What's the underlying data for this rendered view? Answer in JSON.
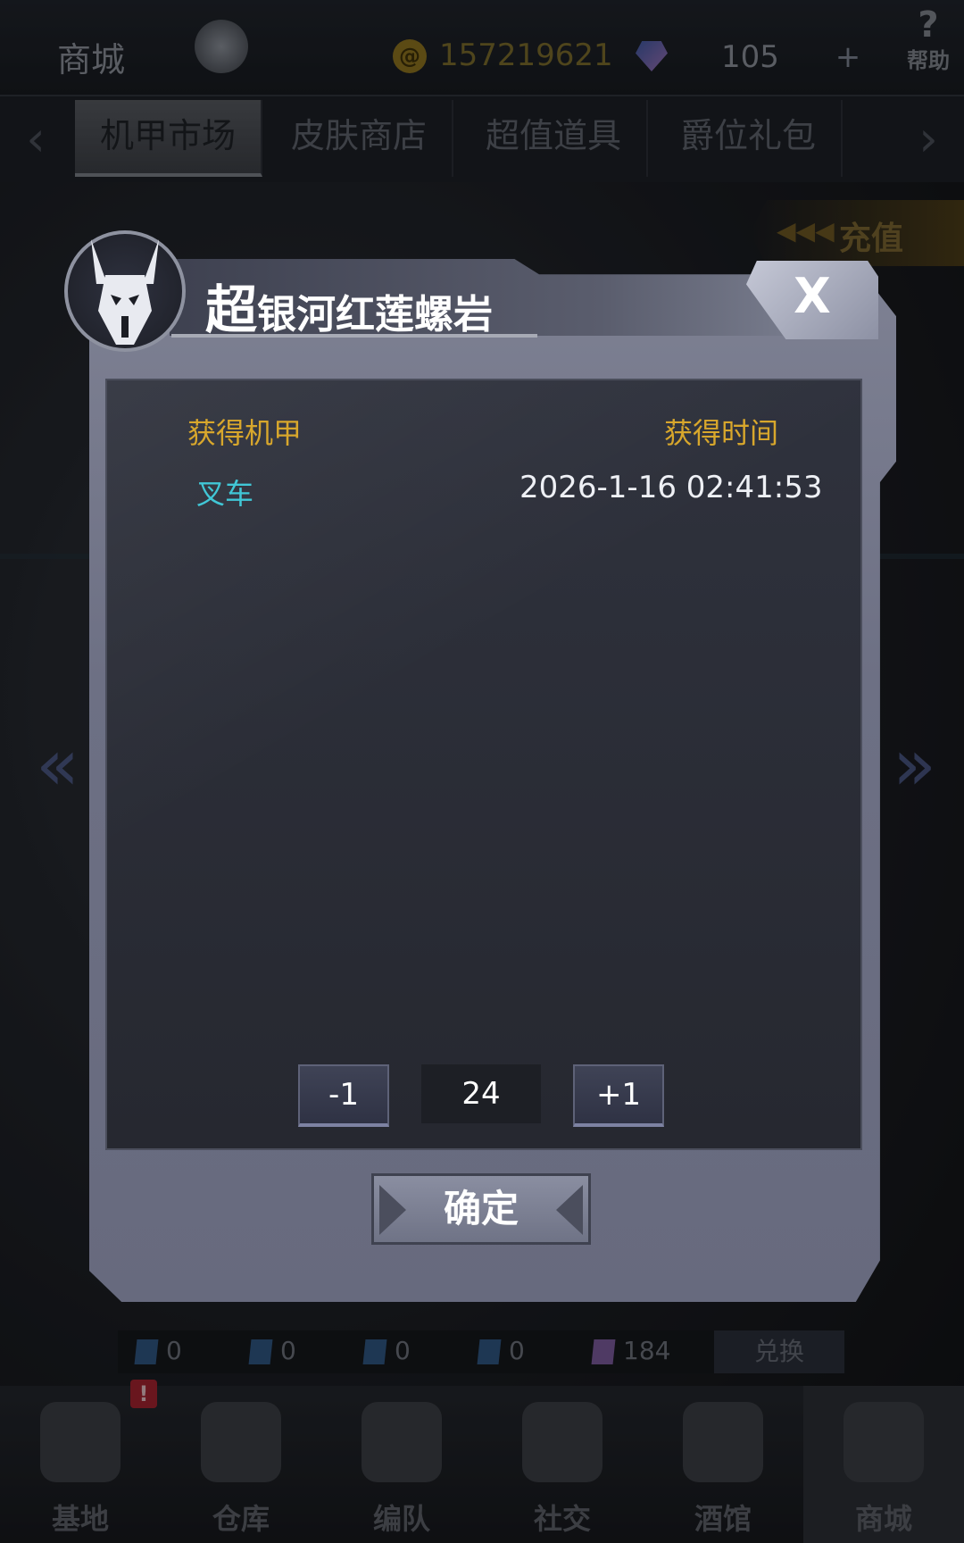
{
  "header": {
    "title": "商城",
    "coins": "157219621",
    "gems": "105",
    "plus_label": "+",
    "help_glyph": "?",
    "help_label": "帮助"
  },
  "tabs": [
    {
      "label": "机甲市场",
      "active": true
    },
    {
      "label": "皮肤商店",
      "active": false
    },
    {
      "label": "超值道具",
      "active": false
    },
    {
      "label": "爵位礼包",
      "active": false
    }
  ],
  "recharge": {
    "label": "充值",
    "arrows": "◀◀◀"
  },
  "modal": {
    "title_prefix": "超",
    "title_rest": "银河红莲螺岩",
    "close_label": "X",
    "columns": {
      "mech": "获得机甲",
      "time": "获得时间"
    },
    "rows": [
      {
        "mech": "叉车",
        "time": "2026-1-16 02:41:53"
      }
    ],
    "stepper": {
      "minus_label": "-1",
      "value": "24",
      "plus_label": "+1"
    },
    "confirm_label": "确定"
  },
  "resources": [
    {
      "icon": "blue-card-icon",
      "value": "0"
    },
    {
      "icon": "blue-card-icon",
      "value": "0"
    },
    {
      "icon": "teal-card-icon",
      "value": "0"
    },
    {
      "icon": "blue-card-icon",
      "value": "0"
    },
    {
      "icon": "purple-crystal-icon",
      "value": "184"
    }
  ],
  "exchange_label": "兑换",
  "nav": [
    {
      "label": "基地",
      "badge": "!"
    },
    {
      "label": "仓库"
    },
    {
      "label": "编队"
    },
    {
      "label": "社交"
    },
    {
      "label": "酒馆"
    },
    {
      "label": "商城",
      "active": true
    }
  ],
  "colors": {
    "accent_gold": "#d8a72c",
    "mech_name": "#41c7d6",
    "modal_frame": "#6d7084"
  }
}
